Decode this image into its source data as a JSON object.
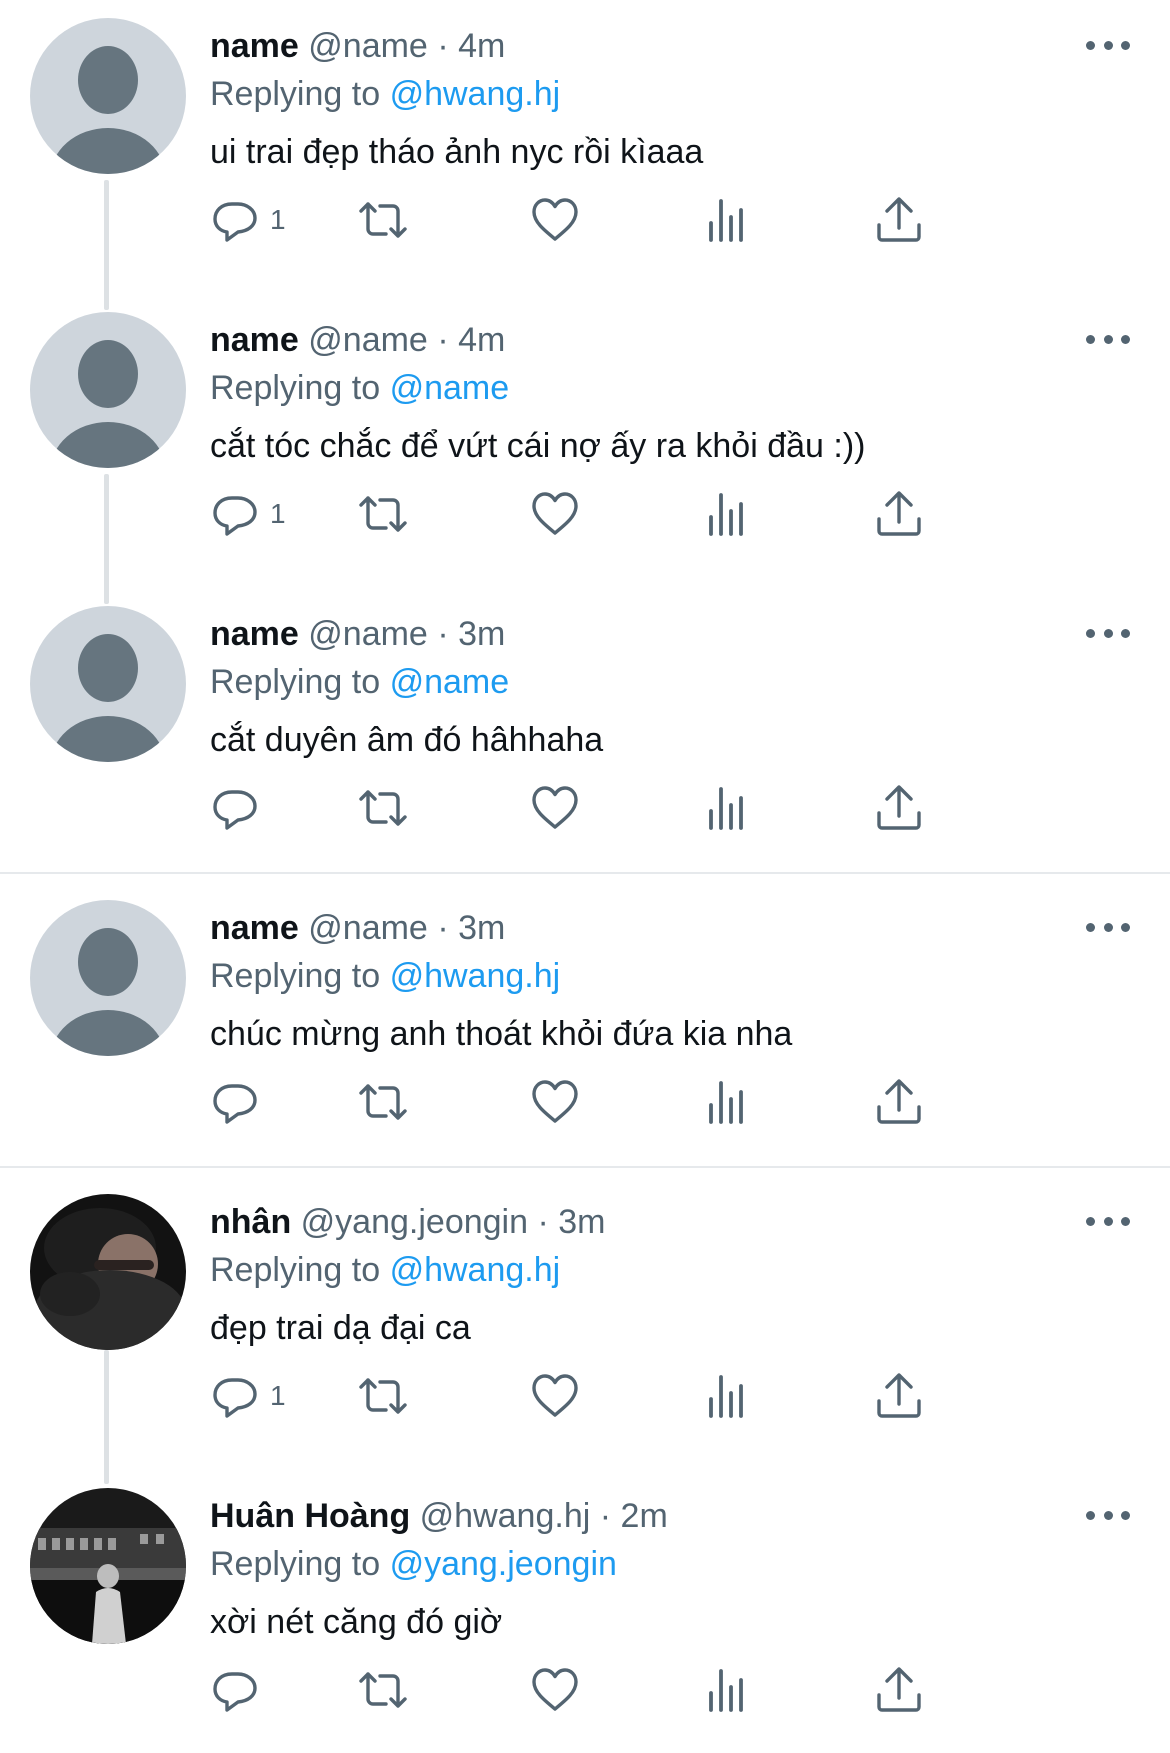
{
  "colors": {
    "accent": "#1d9bf0",
    "secondary_text": "#536471",
    "primary_text": "#0f1419",
    "divider": "#e6e9ec"
  },
  "icons": {
    "reply": "speech-bubble-icon",
    "retweet": "retweet-icon",
    "like": "heart-icon",
    "views": "bar-chart-icon",
    "share": "share-upload-icon",
    "more": "more-dots-icon"
  },
  "tweets": [
    {
      "name": "name",
      "handle": "@name",
      "dot": "·",
      "time": "4m",
      "replying_prefix": "Replying to",
      "replying_to": "@hwang.hj",
      "text": "ui trai đẹp tháo ảnh nyc rồi kìaaa",
      "reply_count": "1",
      "avatar": "default"
    },
    {
      "name": "name",
      "handle": "@name",
      "dot": "·",
      "time": "4m",
      "replying_prefix": "Replying to",
      "replying_to": "@name",
      "text": "cắt tóc chắc để vứt cái nợ ấy ra khỏi đầu :))",
      "reply_count": "1",
      "avatar": "default"
    },
    {
      "name": "name",
      "handle": "@name",
      "dot": "·",
      "time": "3m",
      "replying_prefix": "Replying to",
      "replying_to": "@name",
      "text": "cắt duyên âm đó hâhhaha",
      "reply_count": "",
      "avatar": "default"
    },
    {
      "name": "name",
      "handle": "@name",
      "dot": "·",
      "time": "3m",
      "replying_prefix": "Replying to",
      "replying_to": "@hwang.hj",
      "text": "chúc mừng anh thoát khỏi đứa kia nha",
      "reply_count": "",
      "avatar": "default"
    },
    {
      "name": "nhân",
      "handle": "@yang.jeongin",
      "dot": "·",
      "time": "3m",
      "replying_prefix": "Replying to",
      "replying_to": "@hwang.hj",
      "text": "đẹp trai dạ đại ca",
      "reply_count": "1",
      "avatar": "photo-dark-portrait"
    },
    {
      "name": "Huân Hoàng",
      "handle": "@hwang.hj",
      "dot": "·",
      "time": "2m",
      "replying_prefix": "Replying to",
      "replying_to": "@yang.jeongin",
      "text": "xời nét căng đó giờ",
      "reply_count": "",
      "avatar": "photo-night-street"
    }
  ]
}
